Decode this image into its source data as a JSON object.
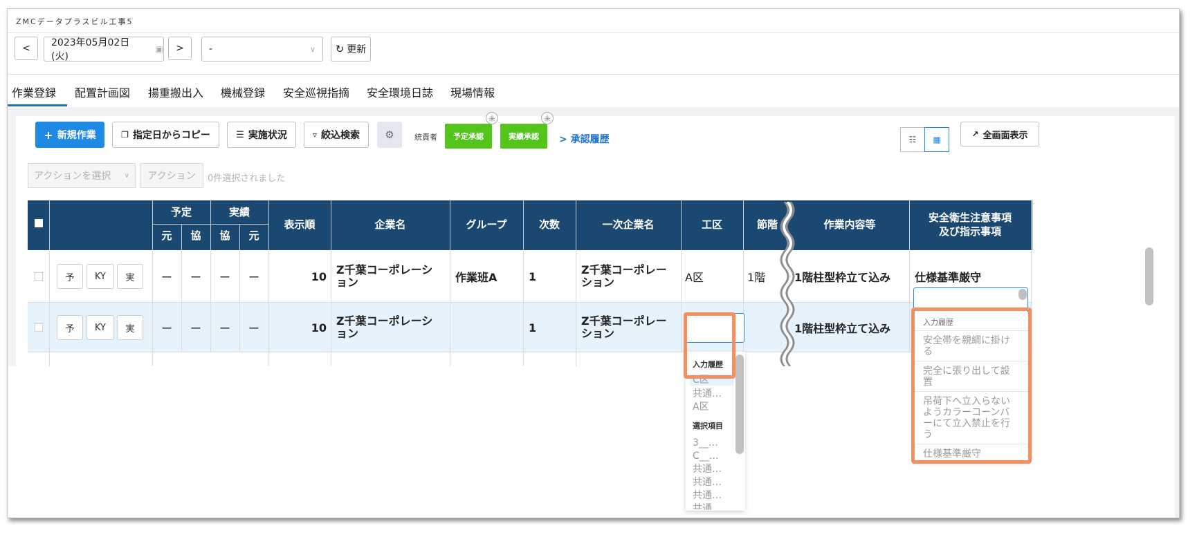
{
  "app": {
    "title": "ZMCデータプラスビル工事5"
  },
  "toolbar": {
    "prev_icon": "<",
    "date": "2023年05月02日 (火)",
    "calendar_icon": "calendar-icon",
    "next_icon": ">",
    "select_value": "-",
    "refresh_label": "更新"
  },
  "tabs": [
    "作業登録",
    "配置計画図",
    "揚重搬出入",
    "機械登録",
    "安全巡視指摘",
    "安全環境日誌",
    "現場情報"
  ],
  "actions": {
    "new_work": "新規作業",
    "copy_from_date": "指定日からコピー",
    "status": "実施状況",
    "filter": "絞込検索",
    "supervisor_label": "統責者",
    "plan_approval": "予定承認",
    "actual_approval": "実績承認",
    "badge": "未",
    "approval_history": "承認履歴",
    "fullscreen": "全画面表示",
    "action_select": "アクションを選択",
    "action_button": "アクション",
    "selected_count": "0件選択されました"
  },
  "table": {
    "headers": {
      "yotei": "予定",
      "jisseki": "実績",
      "moto": "元",
      "kyo": "協",
      "order": "表示順",
      "company": "企業名",
      "group": "グループ",
      "tier": "次数",
      "primary_company": "一次企業名",
      "area": "工区",
      "floor": "節階",
      "work": "作業内容等",
      "safety_line1": "安全衛生注意事項",
      "safety_line2": "及び指示事項"
    },
    "row_buttons": {
      "plan": "予",
      "ky": "KY",
      "actual": "実"
    },
    "dash": "ー",
    "rows": [
      {
        "order": "10",
        "company_line1": "Z千葉コーポレーシ",
        "company_line2": "ョン",
        "group": "作業班A",
        "tier": "1",
        "primary_line1": "Z千葉コーポレー",
        "primary_line2": "ション",
        "area": "A区",
        "floor": "1階",
        "work": "1階柱型枠立て込み",
        "safety": "仕様基準厳守"
      },
      {
        "order": "10",
        "company_line1": "Z千葉コーポレーシ",
        "company_line2": "ョン",
        "group": "",
        "tier": "1",
        "primary_line1": "Z千葉コーポレー",
        "primary_line2": "ション",
        "area": "",
        "floor": "",
        "work": "1階柱型枠立て込み",
        "safety": ""
      }
    ]
  },
  "area_dropdown": {
    "history_title": "入力履歴",
    "history": [
      "C区",
      "共通…",
      "A区"
    ],
    "options_title": "選択項目",
    "options": [
      "3__…",
      "C__…",
      "共通…",
      "共通…",
      "共通…",
      "共通…"
    ]
  },
  "safety_dropdown": {
    "history_title": "入力履歴",
    "items": [
      {
        "line1": "安全帯を親綱に掛け",
        "line2": "る"
      },
      {
        "line1": "完全に張り出して設",
        "line2": "置"
      },
      {
        "line1": "吊荷下へ立入らない",
        "line2": "ようカラーコーンバ",
        "line3": "ーにて立入禁止を行",
        "line4": "う"
      },
      {
        "line1": "仕様基準厳守"
      }
    ]
  },
  "colors": {
    "header_bg": "#1b4870",
    "primary": "#1f8ae6",
    "approve": "#52c41a",
    "highlight": "#f2905f",
    "selected_row": "#e6f3fc"
  }
}
